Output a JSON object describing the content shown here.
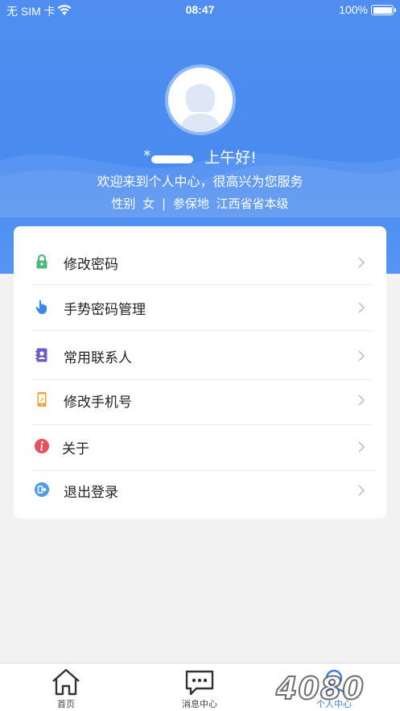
{
  "status_bar": {
    "carrier": "无 SIM 卡",
    "time": "08:47",
    "battery": "100%"
  },
  "profile": {
    "name_masked": "*",
    "greeting": "上午好!",
    "welcome": "欢迎来到个人中心，很高兴为您服务",
    "gender_label": "性别",
    "gender_value": "女",
    "separator": "|",
    "insured_label": "参保地",
    "insured_value": "江西省省本级"
  },
  "menu": [
    {
      "label": "修改密码",
      "icon": "lock-icon",
      "color": "#4cb87a"
    },
    {
      "label": "手势密码管理",
      "icon": "hand-pointer-icon",
      "color": "#3a86e8"
    },
    {
      "label": "常用联系人",
      "icon": "contacts-icon",
      "color": "#6b5fc7"
    },
    {
      "label": "修改手机号",
      "icon": "phone-icon",
      "color": "#f0a030"
    },
    {
      "label": "关于",
      "icon": "info-icon",
      "color": "#e8505b"
    },
    {
      "label": "退出登录",
      "icon": "logout-icon",
      "color": "#4a9be8"
    }
  ],
  "tabs": [
    {
      "label": "首页",
      "icon": "home-icon"
    },
    {
      "label": "消息中心",
      "icon": "message-icon"
    },
    {
      "label": "个人中心",
      "icon": "person-icon",
      "active": true
    }
  ],
  "watermark": "4080"
}
